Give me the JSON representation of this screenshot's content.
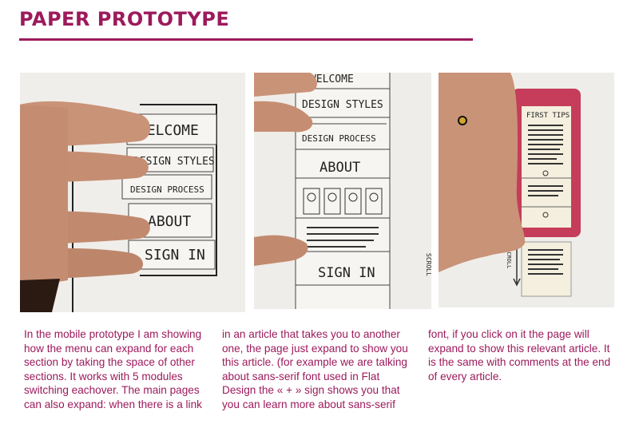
{
  "heading": "PAPER PROTOTYPE",
  "photos": [
    {
      "labels": [
        "WELCOME",
        "DESIGN STYLES",
        "DESIGN PROCESS",
        "ABOUT",
        "SIGN IN"
      ]
    },
    {
      "labels": [
        "WELCOME",
        "DESIGN STYLES",
        "DESIGN PROCESS",
        "ABOUT",
        "SIGN IN"
      ],
      "side_label": "SCROLL"
    },
    {
      "labels": [
        "FIRST TIPS"
      ],
      "side_label": "SCROLL"
    }
  ],
  "columns": [
    "In the mobile prototype I am showing how the menu can expand for each section by taking the space of other sections. It works with 5 modules switching eachover. The main pages can also expand: when there is a link",
    "in an article that takes you to another one, the page just expand to show you this article. (for example we are talking about sans-serif font used in Flat Design the « + » sign shows you that you can learn more about sans-serif",
    "font, if you click on it the page will expand to show this relevant article. It is the same with comments at the end of every article."
  ]
}
